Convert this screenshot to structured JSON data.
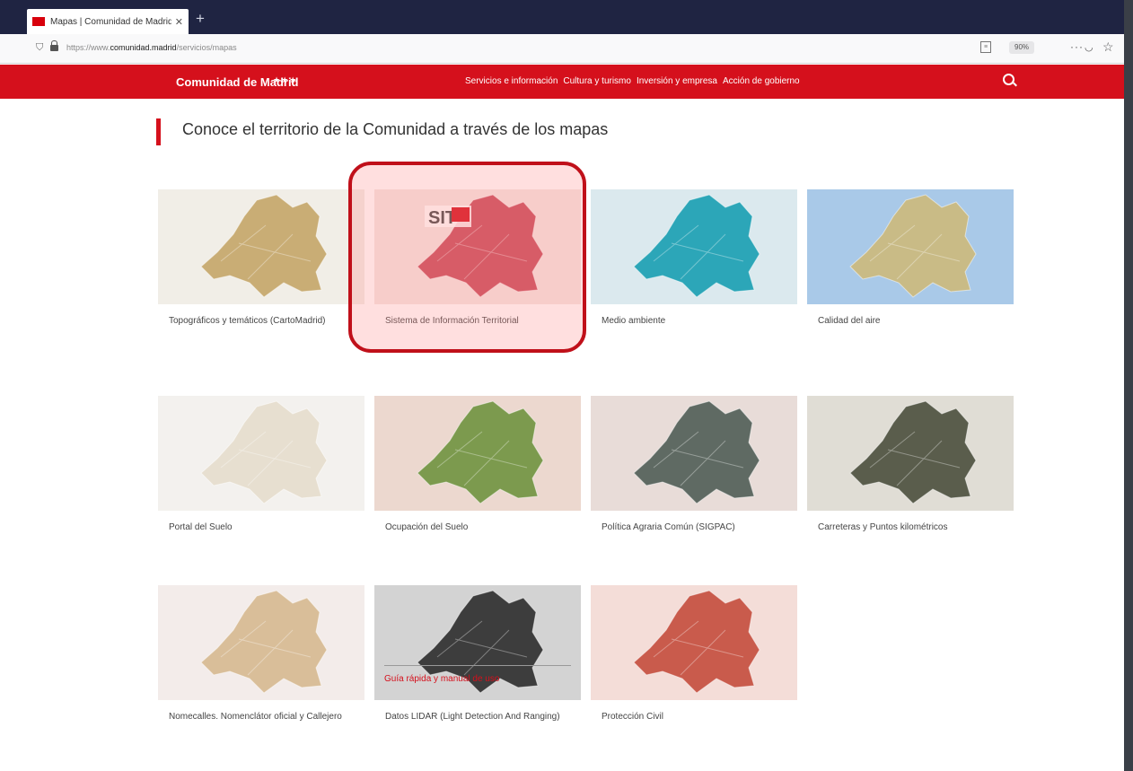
{
  "browser": {
    "tab_title": "Mapas | Comunidad de Madrid",
    "tab_close": "✕",
    "new_tab": "+",
    "url_pre": "https://www.",
    "url_domain": "comunidad.madrid",
    "url_path": "/servicios/mapas",
    "zoom": "90%"
  },
  "nav": {
    "brand": "Comunidad de Madrid",
    "links": [
      "Servicios e información",
      "Cultura y turismo",
      "Inversión y empresa",
      "Acción de gobierno"
    ]
  },
  "page": {
    "title": "Conoce el territorio de la Comunidad a través de los mapas",
    "guide_link": "Guía rápida y manual de uso"
  },
  "cards": [
    {
      "label": "Topográficos y temáticos (CartoMadrid)",
      "bg": "#f1eee7",
      "fill": "#c9ad75"
    },
    {
      "label": "Sistema de Información Territorial",
      "bg": "#f4e6e2",
      "fill": "#c84a59",
      "logo": "SIT"
    },
    {
      "label": "Medio ambiente",
      "bg": "#dbe9ee",
      "fill": "#2ca6b8"
    },
    {
      "label": "Calidad del aire",
      "bg": "#a9c9e8",
      "fill": "#c9bb86"
    },
    {
      "label": "Portal del Suelo",
      "bg": "#f3f1ee",
      "fill": "#e7dfd0"
    },
    {
      "label": "Ocupación del Suelo",
      "bg": "#ecd8cf",
      "fill": "#7c9a4e"
    },
    {
      "label": "Política Agraria Común (SIGPAC)",
      "bg": "#e8dcd8",
      "fill": "#5f6a63"
    },
    {
      "label": "Carreteras y Puntos kilométricos",
      "bg": "#e0ddd5",
      "fill": "#5a5d4c"
    },
    {
      "label": "Nomecalles. Nomenclátor oficial y Callejero",
      "bg": "#f3ecea",
      "fill": "#d9be99"
    },
    {
      "label": "Datos LIDAR (Light Detection And Ranging)",
      "bg": "#d3d3d3",
      "fill": "#3d3d3d"
    },
    {
      "label": "Protección Civil",
      "bg": "#f4ddd8",
      "fill": "#c95b4c"
    }
  ]
}
